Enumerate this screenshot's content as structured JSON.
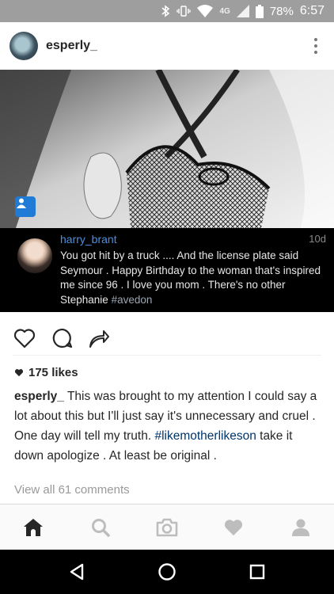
{
  "status_bar": {
    "network": "4G",
    "battery": "78%",
    "time": "6:57",
    "icons": [
      "bluetooth-icon",
      "vibrate-icon",
      "wifi-icon",
      "signal-icon",
      "battery-icon"
    ]
  },
  "post": {
    "username": "esperly_",
    "photo": {
      "comment": {
        "username": "harry_brant",
        "time": "10d",
        "text": "You got hit by a truck .... And the license plate said Seymour . Happy Birthday to the woman that's inspired me since 96 . I love you mom . There's no other Stephanie ",
        "hashtag": "#avedon"
      }
    },
    "likes": "175 likes",
    "caption": {
      "username": "esperly_",
      "text_1": " This was brought to my attention  I could say a lot about this but I'll just say it's unnecessary and cruel . One day will tell my truth. ",
      "hashtag": "#likemotherlikeson",
      "text_2": " take it down apologize . At least be original ."
    },
    "view_comments": "View all 61 comments"
  },
  "bottom_nav": [
    "home-icon",
    "search-icon",
    "camera-icon",
    "heart-icon",
    "profile-icon"
  ],
  "colors": {
    "link_blue": "#4a90e2",
    "hashtag_blue": "#003569",
    "tag_button": "#1f7bd6"
  }
}
